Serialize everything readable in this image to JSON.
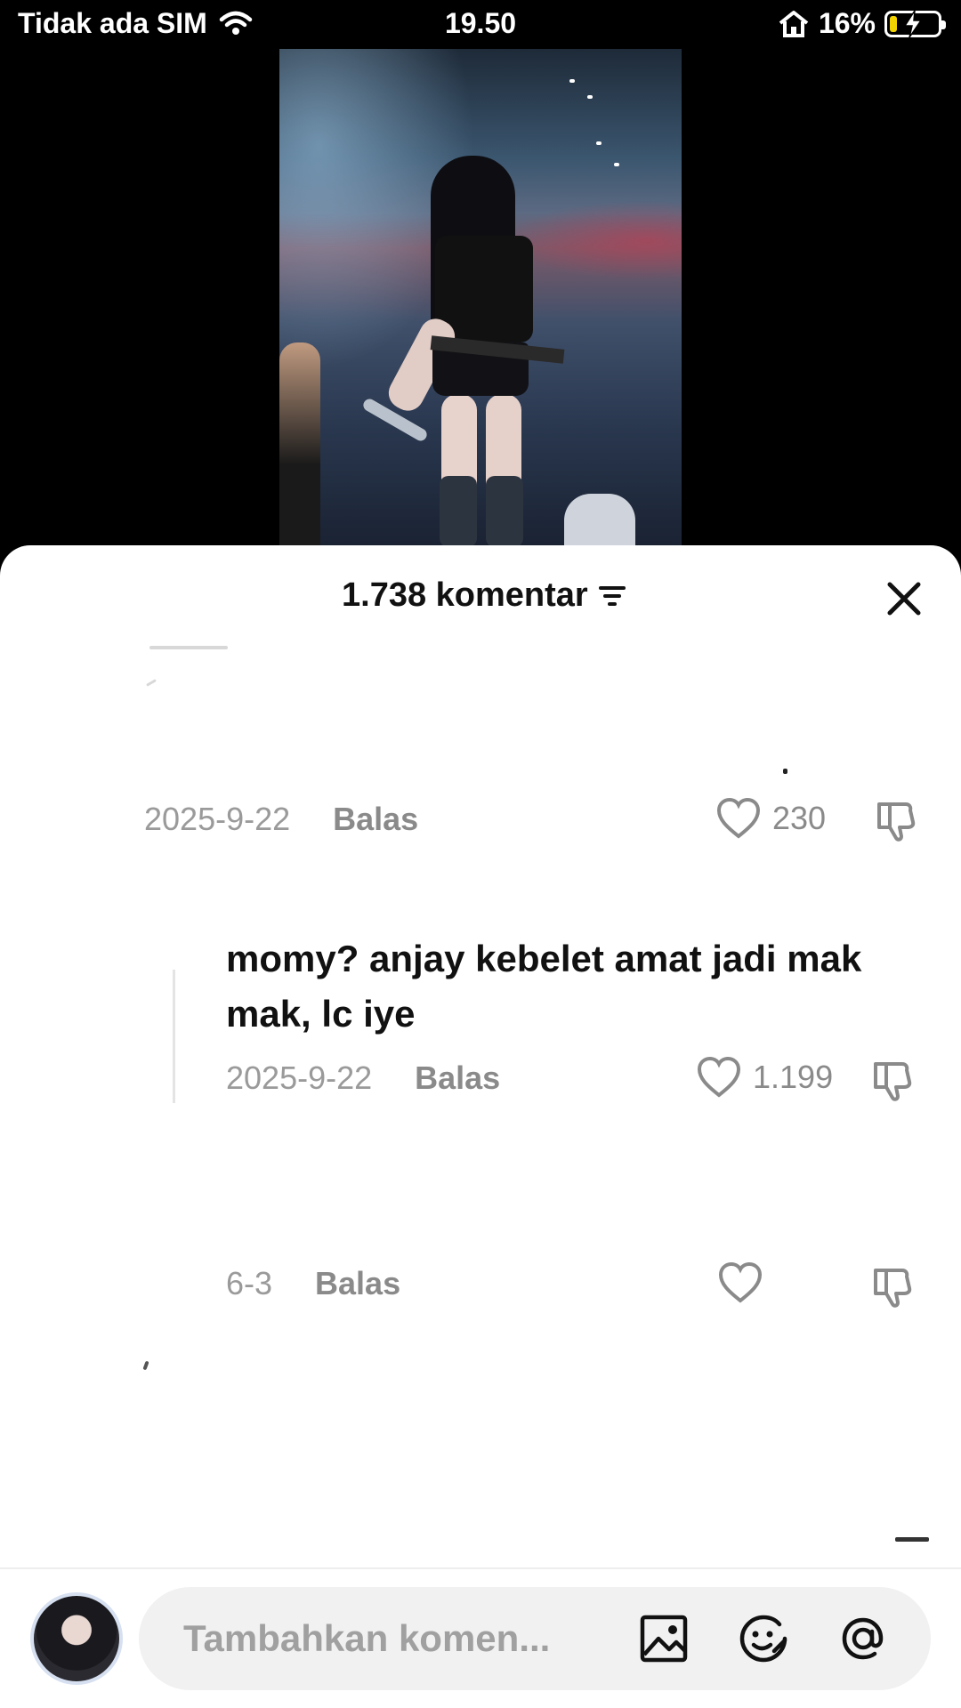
{
  "status_bar": {
    "carrier": "Tidak ada SIM",
    "time": "19.50",
    "battery": "16%",
    "battery_level": 0.16,
    "battery_color": "#f2d200"
  },
  "video": {
    "description_icon": "concert-video"
  },
  "comments_sheet": {
    "count_label": "1.738 komentar",
    "sort_icon": "filter-lines-icon",
    "close_icon": "close-icon",
    "comments": [
      {
        "date": "2025-9-22",
        "reply_label": "Balas",
        "likes": "230"
      },
      {
        "text": "momy? anjay kebelet amat jadi mak mak, lc iye",
        "date": "2025-9-22",
        "reply_label": "Balas",
        "likes": "1.199"
      },
      {
        "date": "6-3",
        "reply_label": "Balas",
        "likes": ""
      }
    ]
  },
  "composer": {
    "placeholder": "Tambahkan komen...",
    "icons": [
      "image-icon",
      "emoji-icon",
      "mention-icon"
    ]
  }
}
